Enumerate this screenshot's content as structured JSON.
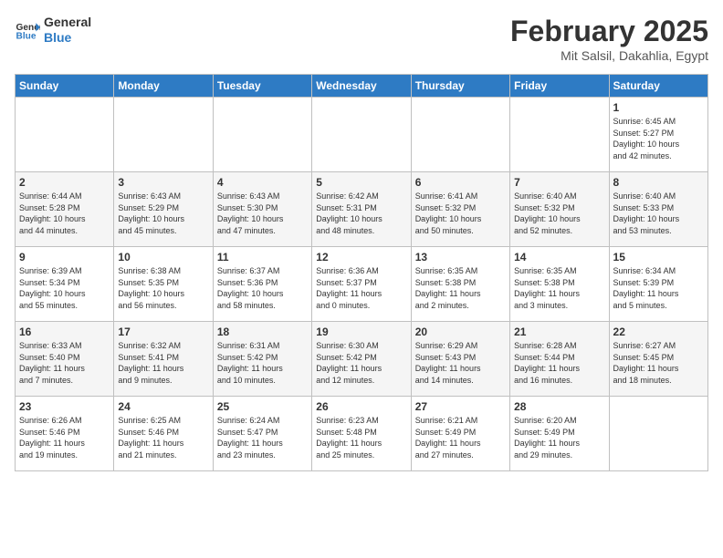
{
  "logo": {
    "line1": "General",
    "line2": "Blue"
  },
  "title": "February 2025",
  "subtitle": "Mit Salsil, Dakahlia, Egypt",
  "days": [
    "Sunday",
    "Monday",
    "Tuesday",
    "Wednesday",
    "Thursday",
    "Friday",
    "Saturday"
  ],
  "weeks": [
    [
      {
        "day": "",
        "info": ""
      },
      {
        "day": "",
        "info": ""
      },
      {
        "day": "",
        "info": ""
      },
      {
        "day": "",
        "info": ""
      },
      {
        "day": "",
        "info": ""
      },
      {
        "day": "",
        "info": ""
      },
      {
        "day": "1",
        "info": "Sunrise: 6:45 AM\nSunset: 5:27 PM\nDaylight: 10 hours\nand 42 minutes."
      }
    ],
    [
      {
        "day": "2",
        "info": "Sunrise: 6:44 AM\nSunset: 5:28 PM\nDaylight: 10 hours\nand 44 minutes."
      },
      {
        "day": "3",
        "info": "Sunrise: 6:43 AM\nSunset: 5:29 PM\nDaylight: 10 hours\nand 45 minutes."
      },
      {
        "day": "4",
        "info": "Sunrise: 6:43 AM\nSunset: 5:30 PM\nDaylight: 10 hours\nand 47 minutes."
      },
      {
        "day": "5",
        "info": "Sunrise: 6:42 AM\nSunset: 5:31 PM\nDaylight: 10 hours\nand 48 minutes."
      },
      {
        "day": "6",
        "info": "Sunrise: 6:41 AM\nSunset: 5:32 PM\nDaylight: 10 hours\nand 50 minutes."
      },
      {
        "day": "7",
        "info": "Sunrise: 6:40 AM\nSunset: 5:32 PM\nDaylight: 10 hours\nand 52 minutes."
      },
      {
        "day": "8",
        "info": "Sunrise: 6:40 AM\nSunset: 5:33 PM\nDaylight: 10 hours\nand 53 minutes."
      }
    ],
    [
      {
        "day": "9",
        "info": "Sunrise: 6:39 AM\nSunset: 5:34 PM\nDaylight: 10 hours\nand 55 minutes."
      },
      {
        "day": "10",
        "info": "Sunrise: 6:38 AM\nSunset: 5:35 PM\nDaylight: 10 hours\nand 56 minutes."
      },
      {
        "day": "11",
        "info": "Sunrise: 6:37 AM\nSunset: 5:36 PM\nDaylight: 10 hours\nand 58 minutes."
      },
      {
        "day": "12",
        "info": "Sunrise: 6:36 AM\nSunset: 5:37 PM\nDaylight: 11 hours\nand 0 minutes."
      },
      {
        "day": "13",
        "info": "Sunrise: 6:35 AM\nSunset: 5:38 PM\nDaylight: 11 hours\nand 2 minutes."
      },
      {
        "day": "14",
        "info": "Sunrise: 6:35 AM\nSunset: 5:38 PM\nDaylight: 11 hours\nand 3 minutes."
      },
      {
        "day": "15",
        "info": "Sunrise: 6:34 AM\nSunset: 5:39 PM\nDaylight: 11 hours\nand 5 minutes."
      }
    ],
    [
      {
        "day": "16",
        "info": "Sunrise: 6:33 AM\nSunset: 5:40 PM\nDaylight: 11 hours\nand 7 minutes."
      },
      {
        "day": "17",
        "info": "Sunrise: 6:32 AM\nSunset: 5:41 PM\nDaylight: 11 hours\nand 9 minutes."
      },
      {
        "day": "18",
        "info": "Sunrise: 6:31 AM\nSunset: 5:42 PM\nDaylight: 11 hours\nand 10 minutes."
      },
      {
        "day": "19",
        "info": "Sunrise: 6:30 AM\nSunset: 5:42 PM\nDaylight: 11 hours\nand 12 minutes."
      },
      {
        "day": "20",
        "info": "Sunrise: 6:29 AM\nSunset: 5:43 PM\nDaylight: 11 hours\nand 14 minutes."
      },
      {
        "day": "21",
        "info": "Sunrise: 6:28 AM\nSunset: 5:44 PM\nDaylight: 11 hours\nand 16 minutes."
      },
      {
        "day": "22",
        "info": "Sunrise: 6:27 AM\nSunset: 5:45 PM\nDaylight: 11 hours\nand 18 minutes."
      }
    ],
    [
      {
        "day": "23",
        "info": "Sunrise: 6:26 AM\nSunset: 5:46 PM\nDaylight: 11 hours\nand 19 minutes."
      },
      {
        "day": "24",
        "info": "Sunrise: 6:25 AM\nSunset: 5:46 PM\nDaylight: 11 hours\nand 21 minutes."
      },
      {
        "day": "25",
        "info": "Sunrise: 6:24 AM\nSunset: 5:47 PM\nDaylight: 11 hours\nand 23 minutes."
      },
      {
        "day": "26",
        "info": "Sunrise: 6:23 AM\nSunset: 5:48 PM\nDaylight: 11 hours\nand 25 minutes."
      },
      {
        "day": "27",
        "info": "Sunrise: 6:21 AM\nSunset: 5:49 PM\nDaylight: 11 hours\nand 27 minutes."
      },
      {
        "day": "28",
        "info": "Sunrise: 6:20 AM\nSunset: 5:49 PM\nDaylight: 11 hours\nand 29 minutes."
      },
      {
        "day": "",
        "info": ""
      }
    ]
  ]
}
